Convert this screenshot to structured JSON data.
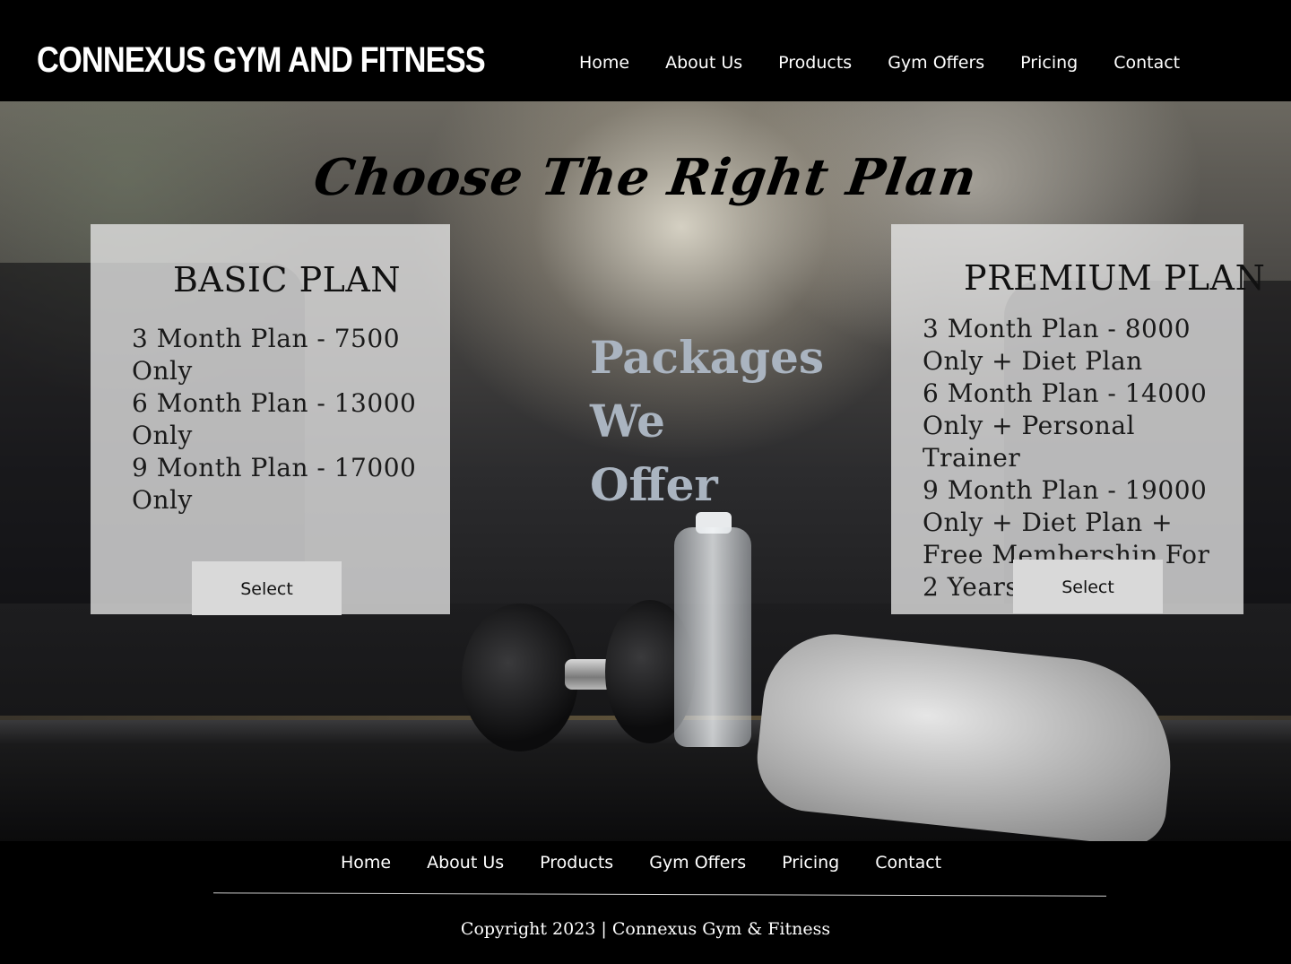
{
  "header": {
    "brand": "CONNEXUS GYM AND FITNESS",
    "nav": [
      "Home",
      "About Us",
      "Products",
      "Gym Offers",
      "Pricing",
      "Contact"
    ]
  },
  "hero": {
    "heading": "Choose The Right Plan",
    "packages_lines": [
      "Packages",
      "We",
      "Offer"
    ]
  },
  "plans": {
    "basic": {
      "title": "BASIC PLAN",
      "features": [
        "3 Month Plan - 7500 Only",
        "6 Month Plan - 13000 Only",
        "9 Month Plan -  17000 Only"
      ],
      "button": "Select"
    },
    "premium": {
      "title": "PREMIUM PLAN",
      "features": [
        "3 Month Plan - 8000 Only + Diet Plan",
        "6 Month Plan - 14000 Only + Personal Trainer",
        "9 Month Plan -  19000 Only + Diet Plan + Free Membership For 2 Years"
      ],
      "button": "Select"
    }
  },
  "footer": {
    "nav": [
      "Home",
      "About Us",
      "Products",
      "Gym Offers",
      "Pricing",
      "Contact"
    ],
    "copyright": "Copyright 2023 | Connexus Gym & Fitness"
  },
  "colors": {
    "background": "#000000",
    "card": "#e6e6e6",
    "packages_text": "#aab4c0",
    "button": "#d9d9d9"
  }
}
